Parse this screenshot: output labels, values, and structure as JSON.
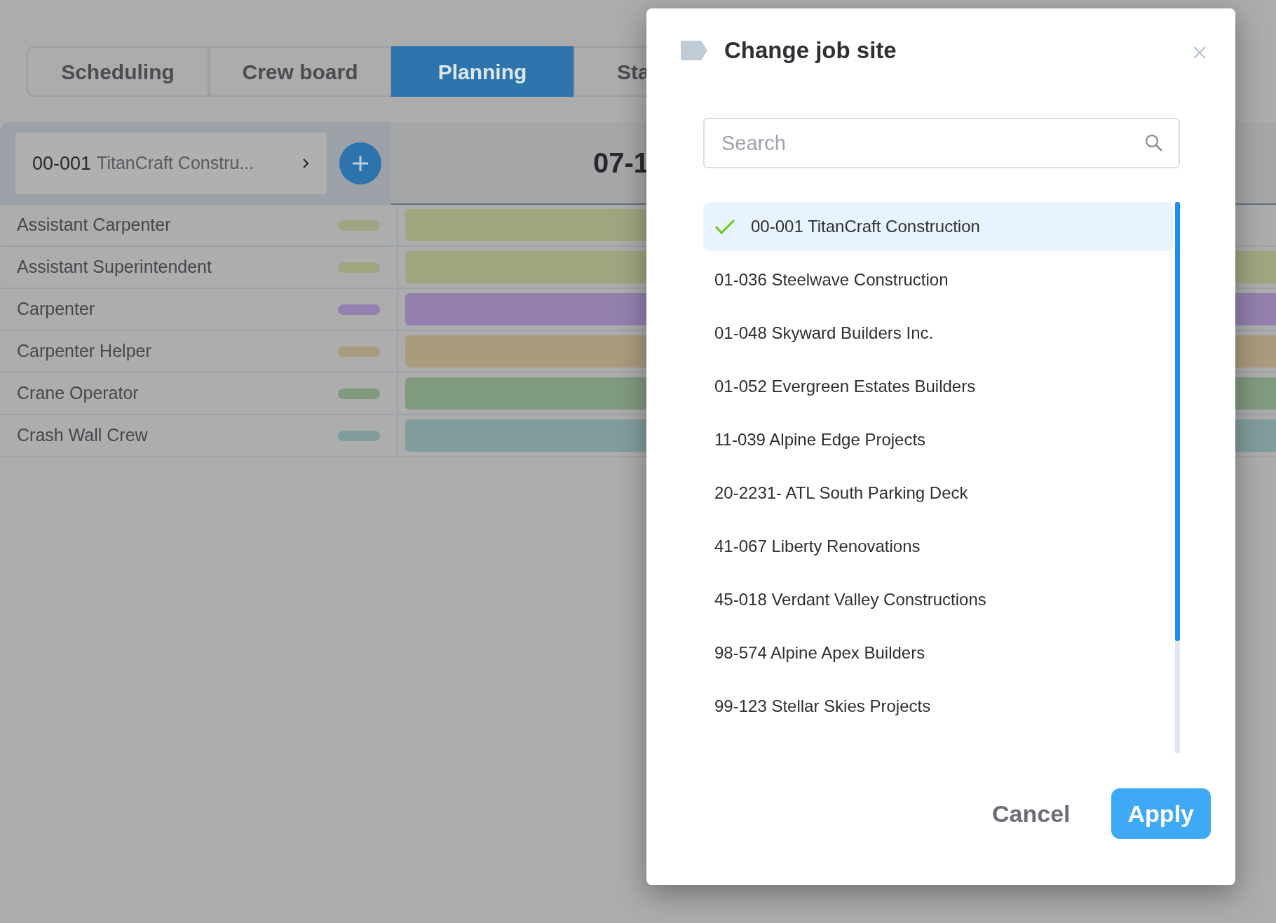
{
  "tabs": [
    {
      "label": "Scheduling",
      "selected": false
    },
    {
      "label": "Crew board",
      "selected": false
    },
    {
      "label": "Planning",
      "selected": true
    },
    {
      "label": "Sta",
      "selected": false
    }
  ],
  "job_selector": {
    "code": "00-001",
    "name": "TitanCraft Constru..."
  },
  "date_header": "07-1",
  "rows": [
    {
      "label": "Assistant Carpenter",
      "color": "#9ea680",
      "extends_right": false
    },
    {
      "label": "Assistant Superintendent",
      "color": "#9ea680",
      "extends_right": true
    },
    {
      "label": "Carpenter",
      "color": "#9380ae",
      "extends_right": true
    },
    {
      "label": "Carpenter Helper",
      "color": "#a99b7e",
      "extends_right": true
    },
    {
      "label": "Crane Operator",
      "color": "#809a7e",
      "extends_right": true
    },
    {
      "label": "Crash Wall Crew",
      "color": "#7f9d9c",
      "extends_right": true
    }
  ],
  "dialog": {
    "title": "Change job site",
    "search": {
      "placeholder": "Search"
    },
    "items": [
      {
        "label": "00-001 TitanCraft Construction",
        "selected": true
      },
      {
        "label": "01-036 Steelwave Construction",
        "selected": false
      },
      {
        "label": "01-048 Skyward Builders Inc.",
        "selected": false
      },
      {
        "label": "01-052 Evergreen Estates Builders",
        "selected": false
      },
      {
        "label": "11-039 Alpine Edge Projects",
        "selected": false
      },
      {
        "label": "20-2231- ATL South Parking Deck",
        "selected": false
      },
      {
        "label": "41-067 Liberty Renovations",
        "selected": false
      },
      {
        "label": "45-018 Verdant Valley Constructions",
        "selected": false
      },
      {
        "label": "98-574 Alpine Apex Builders",
        "selected": false
      },
      {
        "label": "99-123 Stellar Skies Projects",
        "selected": false
      }
    ],
    "buttons": [
      {
        "label": "Cancel",
        "kind": "secondary"
      },
      {
        "label": "Apply",
        "kind": "primary"
      }
    ]
  }
}
